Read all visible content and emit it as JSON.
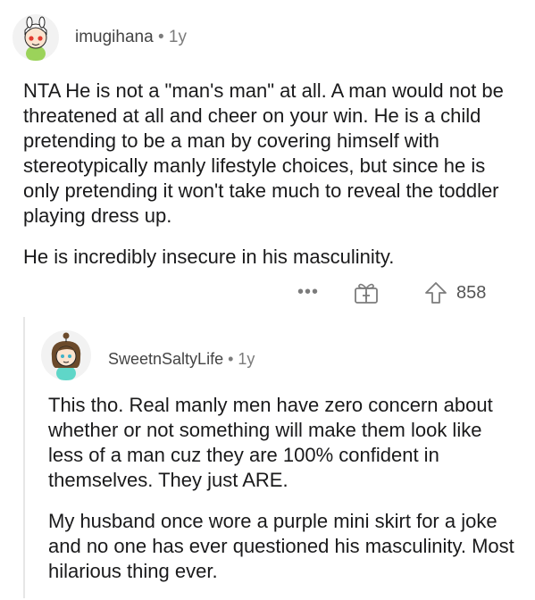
{
  "comments": [
    {
      "username": "imugihana",
      "separator": "•",
      "age": "1y",
      "avatar_icon": "snoo-avatar-icon",
      "paragraphs": [
        "NTA He is not a \"man's man\" at all. A man would not be threatened at all and cheer on your win. He is a child pretending to be a man by covering himself with stereotypically manly lifestyle choices, but since he is only pretending it won't take much to reveal the toddler playing dress up.",
        "He is incredibly insecure in his masculinity."
      ],
      "actions": {
        "more_label": "•••",
        "award_icon": "gift-award-icon",
        "upvote_icon": "upvote-arrow-icon",
        "score": "858"
      }
    },
    {
      "username": "SweetnSaltyLife",
      "separator": "•",
      "age": "1y",
      "avatar_icon": "snoo-avatar-icon",
      "paragraphs": [
        "This tho. Real manly men have zero concern about whether or not something will make them look like less of a man cuz they are 100% confident in themselves. They just ARE.",
        "My husband once wore a purple mini skirt for a joke and no one has ever questioned his masculinity. Most hilarious thing ever."
      ]
    }
  ],
  "colors": {
    "text": "#1a1a1b",
    "meta": "#7c7c7c",
    "avatar_bg": "#f2f2f2",
    "thread_line": "#e6e6e6"
  }
}
